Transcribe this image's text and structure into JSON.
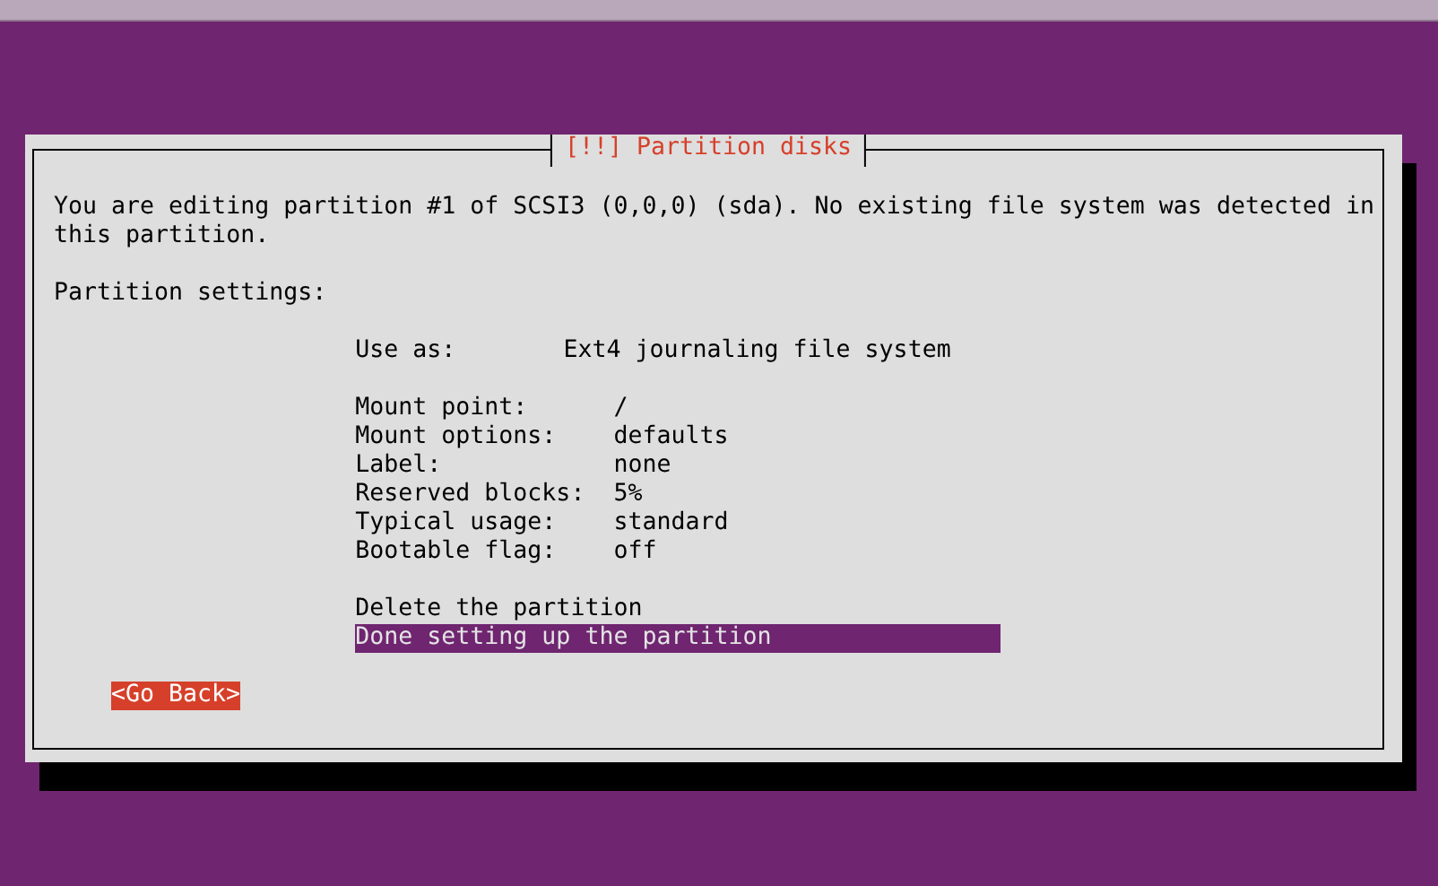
{
  "dialog": {
    "title": "[!!] Partition disks",
    "message": "You are editing partition #1 of SCSI3 (0,0,0) (sda). No existing file system was detected in this partition.",
    "settings_heading": "Partition settings:",
    "use_as": {
      "label": "Use as:",
      "value": "Ext4 journaling file system"
    },
    "settings": [
      {
        "label": "Mount point:",
        "value": "/"
      },
      {
        "label": "Mount options:",
        "value": "defaults"
      },
      {
        "label": "Label:",
        "value": "none"
      },
      {
        "label": "Reserved blocks:",
        "value": "5%"
      },
      {
        "label": "Typical usage:",
        "value": "standard"
      },
      {
        "label": "Bootable flag:",
        "value": "off"
      }
    ],
    "actions": [
      {
        "label": "Delete the partition",
        "selected": false
      },
      {
        "label": "Done setting up the partition",
        "selected": true
      }
    ],
    "back_button": "<Go Back>"
  }
}
